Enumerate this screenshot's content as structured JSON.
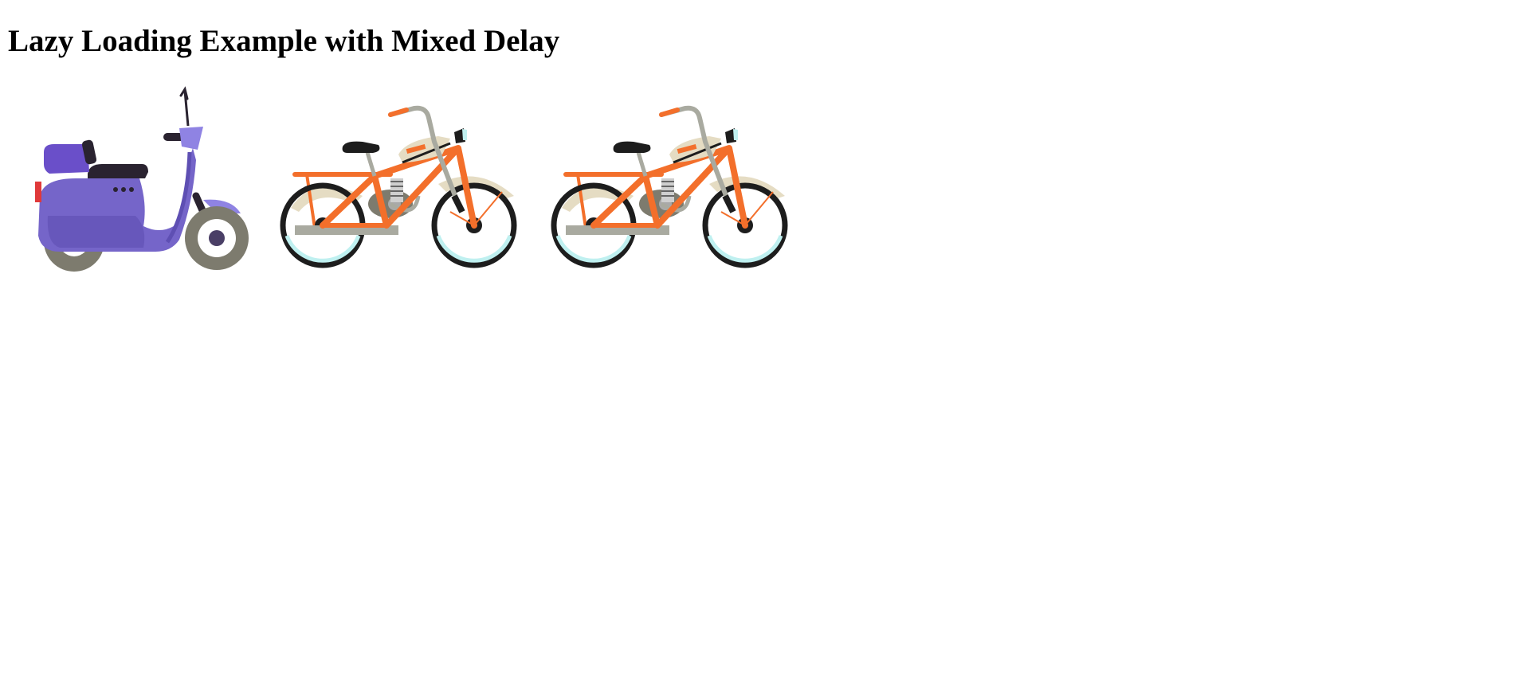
{
  "page": {
    "title": "Lazy Loading Example with Mixed Delay"
  },
  "gallery": {
    "images": [
      {
        "subject": "scooter",
        "main_color": "#7565c9"
      },
      {
        "subject": "bicycle",
        "main_color": "#f36f2b"
      },
      {
        "subject": "bicycle",
        "main_color": "#f36f2b"
      }
    ]
  }
}
